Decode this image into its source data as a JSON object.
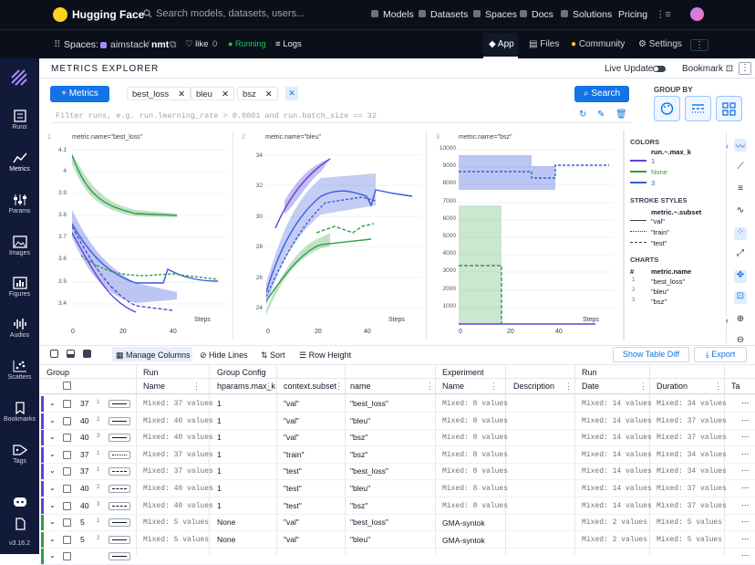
{
  "hf": {
    "brand": "Hugging Face",
    "search_placeholder": "Search models, datasets, users...",
    "nav": [
      "Models",
      "Datasets",
      "Spaces",
      "Docs",
      "Solutions",
      "Pricing"
    ],
    "spaces_label": "Spaces:",
    "owner": "aimstack",
    "repo": "nmt",
    "like": "like",
    "like_count": "0",
    "status": "Running",
    "logs": "Logs",
    "tabs": [
      "App",
      "Files",
      "Community",
      "Settings"
    ]
  },
  "sidebar": {
    "items": [
      "Runs",
      "Metrics",
      "Params",
      "Images",
      "Figures",
      "Audios",
      "Scatters",
      "Bookmarks",
      "Tags"
    ],
    "version": "v3.16.2"
  },
  "explorer": {
    "title": "METRICS EXPLORER",
    "live_update": "Live Update:",
    "bookmark": "Bookmark",
    "metrics_button": "+ Metrics",
    "chips": [
      "best_loss",
      "bleu",
      "bsz"
    ],
    "search_button": "Search",
    "filter_placeholder": "Filter runs, e.g. run.learning_rate > 0.0001 and run.batch_size == 32",
    "group_by": "GROUP BY"
  },
  "charts": {
    "panels": [
      {
        "index": "1",
        "label": "metric.name=\"best_loss\"",
        "yticks": [
          "4.1",
          "4",
          "3.9",
          "3.8",
          "3.7",
          "3.6",
          "3.5",
          "3.4"
        ],
        "xticks": [
          "0",
          "20",
          "40"
        ],
        "xlabel": "Steps"
      },
      {
        "index": "2",
        "label": "metric.name=\"bleu\"",
        "yticks": [
          "34",
          "32",
          "30",
          "28",
          "26",
          "24"
        ],
        "xticks": [
          "0",
          "20",
          "40"
        ],
        "xlabel": "Steps"
      },
      {
        "index": "3",
        "label": "metric.name=\"bsz\"",
        "yticks": [
          "10000",
          "9000",
          "8000",
          "7000",
          "6000",
          "5000",
          "4000",
          "3000",
          "2000",
          "1000"
        ],
        "xticks": [
          "0",
          "20",
          "40"
        ],
        "xlabel": "Steps"
      }
    ],
    "colors": {
      "purple": "#5b45d6",
      "blue": "#3b5bdb",
      "green": "#2f9e44",
      "gray": "#495057"
    }
  },
  "chart_data": [
    {
      "type": "line",
      "label": "metric.name=\"best_loss\"",
      "xlabel": "Steps",
      "ylim": [
        3.35,
        4.15
      ],
      "xlim": [
        0,
        50
      ]
    },
    {
      "type": "line",
      "label": "metric.name=\"bleu\"",
      "xlabel": "Steps",
      "ylim": [
        23.5,
        35
      ],
      "xlim": [
        0,
        50
      ]
    },
    {
      "type": "area",
      "label": "metric.name=\"bsz\"",
      "xlabel": "Steps",
      "ylim": [
        0,
        10000
      ],
      "xlim": [
        0,
        50
      ]
    }
  ],
  "legend": {
    "colors_title": "COLORS",
    "colors_key": "run.~.max_k",
    "color_items": [
      "1",
      "None",
      "3"
    ],
    "stroke_title": "STROKE STYLES",
    "stroke_key": "metric.~.subset",
    "stroke_items": [
      "\"val\"",
      "\"train\"",
      "\"test\""
    ],
    "charts_title": "CHARTS",
    "charts_hash": "#",
    "charts_key": "metric.name",
    "chart_items": [
      {
        "n": "1",
        "v": "\"best_loss\""
      },
      {
        "n": "2",
        "v": "\"bleu\""
      },
      {
        "n": "3",
        "v": "\"bsz\""
      }
    ]
  },
  "table_toolbar": {
    "manage_columns": "Manage Columns",
    "hide_lines": "Hide Lines",
    "sort": "Sort",
    "row_height": "Row Height",
    "show_diff": "Show Table Diff",
    "export": "Export"
  },
  "table": {
    "groups": [
      "Group",
      "Run",
      "Group Config",
      "Experiment",
      "Run"
    ],
    "columns": [
      "Name",
      "hparams.max_k",
      "context.subset",
      "name",
      "Name",
      "Description",
      "Date",
      "Duration",
      "Ta"
    ],
    "rows": [
      {
        "count": "37",
        "idx": "1",
        "name": "Mixed: 37 values",
        "maxk": "1",
        "subset": "\"val\"",
        "mname": "\"best_loss\"",
        "exp": "Mixed: 8 values",
        "date": "Mixed: 14 values",
        "dur": "Mixed: 34 values",
        "color": "#5b45d6",
        "dash": "solid"
      },
      {
        "count": "40",
        "idx": "2",
        "name": "Mixed: 40 values",
        "maxk": "1",
        "subset": "\"val\"",
        "mname": "\"bleu\"",
        "exp": "Mixed: 8 values",
        "date": "Mixed: 14 values",
        "dur": "Mixed: 37 values",
        "color": "#5b45d6",
        "dash": "solid"
      },
      {
        "count": "40",
        "idx": "3",
        "name": "Mixed: 40 values",
        "maxk": "1",
        "subset": "\"val\"",
        "mname": "\"bsz\"",
        "exp": "Mixed: 8 values",
        "date": "Mixed: 14 values",
        "dur": "Mixed: 37 values",
        "color": "#5b45d6",
        "dash": "solid"
      },
      {
        "count": "37",
        "idx": "1",
        "name": "Mixed: 37 values",
        "maxk": "1",
        "subset": "\"train\"",
        "mname": "\"bsz\"",
        "exp": "Mixed: 8 values",
        "date": "Mixed: 14 values",
        "dur": "Mixed: 34 values",
        "color": "#5b45d6",
        "dash": "dotted"
      },
      {
        "count": "37",
        "idx": "1",
        "name": "Mixed: 37 values",
        "maxk": "1",
        "subset": "\"test\"",
        "mname": "\"best_loss\"",
        "exp": "Mixed: 8 values",
        "date": "Mixed: 14 values",
        "dur": "Mixed: 34 values",
        "color": "#5b45d6",
        "dash": "dashed"
      },
      {
        "count": "40",
        "idx": "2",
        "name": "Mixed: 40 values",
        "maxk": "1",
        "subset": "\"test\"",
        "mname": "\"bleu\"",
        "exp": "Mixed: 8 values",
        "date": "Mixed: 14 values",
        "dur": "Mixed: 37 values",
        "color": "#5b45d6",
        "dash": "dashed"
      },
      {
        "count": "40",
        "idx": "3",
        "name": "Mixed: 40 values",
        "maxk": "1",
        "subset": "\"test\"",
        "mname": "\"bsz\"",
        "exp": "Mixed: 8 values",
        "date": "Mixed: 14 values",
        "dur": "Mixed: 37 values",
        "color": "#5b45d6",
        "dash": "dashed"
      },
      {
        "count": "5",
        "idx": "1",
        "name": "Mixed: 5 values",
        "maxk": "None",
        "subset": "\"val\"",
        "mname": "\"best_loss\"",
        "exp": "GMA-syntok",
        "date": "Mixed: 2 values",
        "dur": "Mixed: 5 values",
        "color": "#2f9e44",
        "dash": "solid"
      },
      {
        "count": "5",
        "idx": "2",
        "name": "Mixed: 5 values",
        "maxk": "None",
        "subset": "\"val\"",
        "mname": "\"bleu\"",
        "exp": "GMA-syntok",
        "date": "Mixed: 2 values",
        "dur": "Mixed: 5 values",
        "color": "#2f9e44",
        "dash": "solid"
      },
      {
        "count": "",
        "idx": "",
        "name": "",
        "maxk": "",
        "subset": "",
        "mname": "",
        "exp": "",
        "date": "",
        "dur": "",
        "color": "#2f9e44",
        "dash": "solid"
      }
    ]
  }
}
